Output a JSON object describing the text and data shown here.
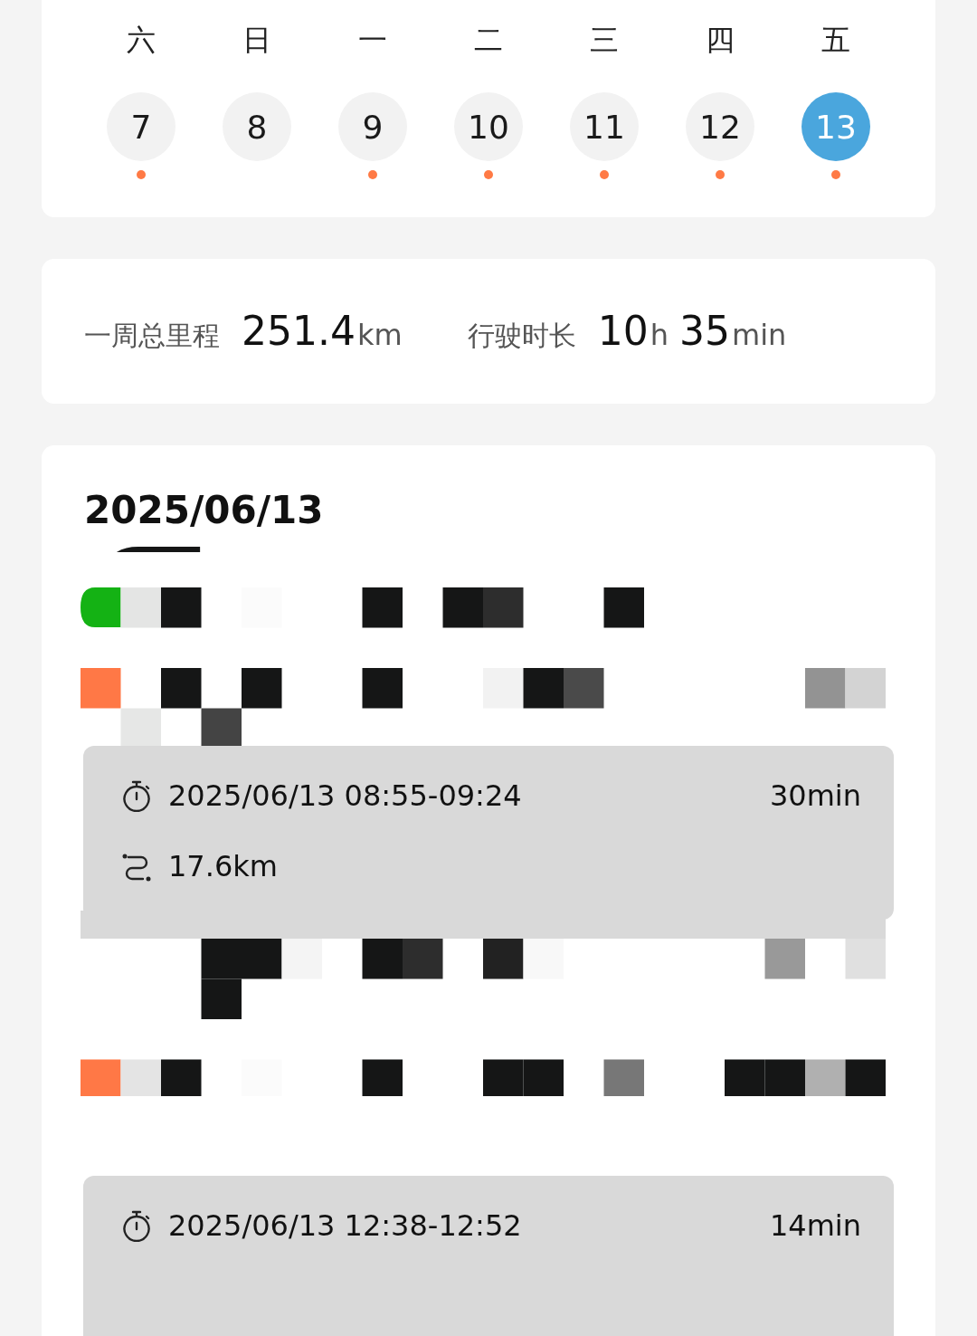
{
  "week_header": [
    "六",
    "日",
    "一",
    "二",
    "三",
    "四",
    "五"
  ],
  "days": [
    {
      "day": "7",
      "selected": false,
      "has_record": true
    },
    {
      "day": "8",
      "selected": false,
      "has_record": false
    },
    {
      "day": "9",
      "selected": false,
      "has_record": true
    },
    {
      "day": "10",
      "selected": false,
      "has_record": true
    },
    {
      "day": "11",
      "selected": false,
      "has_record": true
    },
    {
      "day": "12",
      "selected": false,
      "has_record": true
    },
    {
      "day": "13",
      "selected": true,
      "has_record": true
    }
  ],
  "summary": [
    {
      "label": "一周总里程",
      "parts": [
        {
          "value": "251.4",
          "unit": "km"
        }
      ]
    },
    {
      "label": "行驶时长",
      "parts": [
        {
          "value": "10",
          "unit": "h"
        },
        {
          "value": "35",
          "unit": "min"
        }
      ]
    }
  ],
  "trips_card": {
    "date": "2025/06/13",
    "trips": [
      {
        "time_range": "2025/06/13 08:55-09:24",
        "duration": "30min",
        "distance": "17.6km"
      },
      {
        "time_range": "2025/06/13 12:38-12:52",
        "duration": "14min"
      }
    ]
  }
}
